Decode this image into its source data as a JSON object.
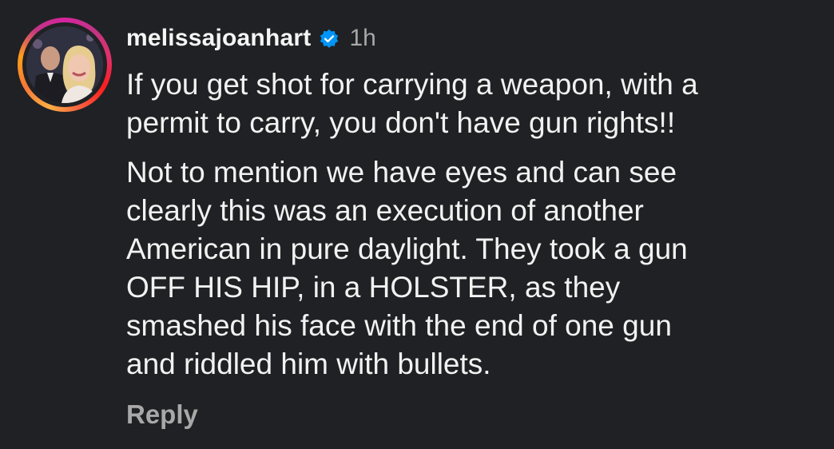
{
  "comment": {
    "username": "melissajoanhart",
    "verified_icon": "verified-badge-icon",
    "timestamp": "1h",
    "paragraph_1_lines": [
      "If you get shot for carrying a weapon, with a",
      "permit to carry, you don't have gun rights!!"
    ],
    "paragraph_2_lines": [
      "Not to mention we have eyes and can see",
      "clearly this was an execution of another",
      "American in pure daylight. They took a gun",
      "OFF HIS HIP, in a HOLSTER, as they",
      "smashed his face with the end of one gun",
      "and riddled him with bullets."
    ],
    "reply_label": "Reply"
  },
  "colors": {
    "background": "#202124",
    "text": "#f2f2f2",
    "muted": "#a8a8a8",
    "verified_blue": "#0095f6"
  }
}
